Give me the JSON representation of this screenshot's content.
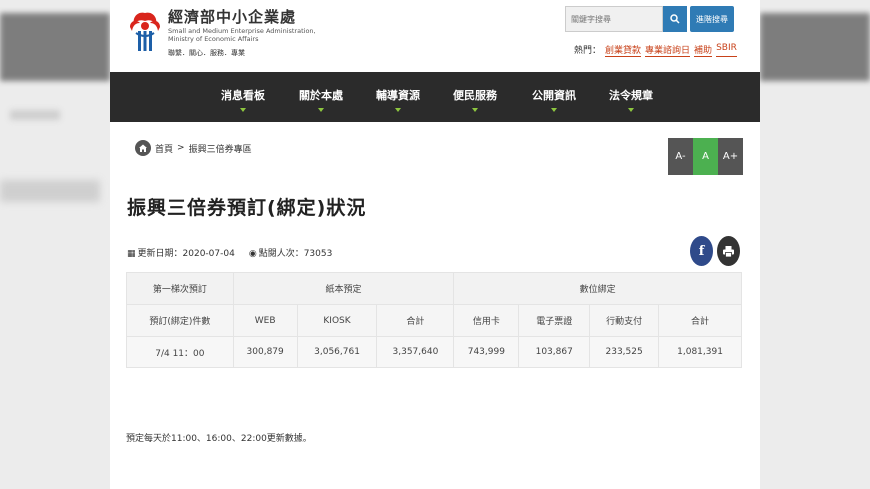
{
  "header": {
    "brand_zh": "經濟部中小企業處",
    "brand_en_1": "Small and Medium Enterprise Administration,",
    "brand_en_2": "Ministry of Economic Affairs",
    "slogan": "聯繫．關心．服務．專業",
    "search_placeholder": "關鍵字搜尋",
    "advanced_search": "進階搜尋",
    "hot_label": "熱門：",
    "hot_links": [
      "創業貸款",
      "專業諮詢日",
      "補助",
      "SBIR"
    ]
  },
  "nav": {
    "items": [
      "消息看板",
      "關於本處",
      "輔導資源",
      "便民服務",
      "公開資訊",
      "法令規章"
    ]
  },
  "breadcrumb": {
    "home": "首頁",
    "separator": ">",
    "current": "振興三倍券專區"
  },
  "font_sizer": {
    "small": "A-",
    "normal": "A",
    "large": "A+"
  },
  "title": "振興三倍券預訂(綁定)狀況",
  "meta": {
    "updated_label": "更新日期：2020-07-04",
    "views_label": "點閱人次：73053"
  },
  "share": {
    "facebook": "f"
  },
  "table": {
    "group_headers": [
      "第一梯次預訂",
      "紙本預定",
      "數位綁定"
    ],
    "sub_headers": [
      "預訂(綁定)件數",
      "WEB",
      "KIOSK",
      "合計",
      "信用卡",
      "電子票證",
      "行動支付",
      "合計"
    ],
    "rows": [
      [
        "7/4 11：00",
        "300,879",
        "3,056,761",
        "3,357,640",
        "743,999",
        "103,867",
        "233,525",
        "1,081,391"
      ]
    ]
  },
  "note": "預定每天於11:00、16:00、22:00更新數據。",
  "colors": {
    "nav_bg": "#2b2b2b",
    "nav_indicator": "#8dc63f",
    "accent_blue": "#2f7bb5",
    "hot_link": "#c8421a",
    "font_normal_active": "#4cb050",
    "facebook": "#2f4a8a"
  }
}
